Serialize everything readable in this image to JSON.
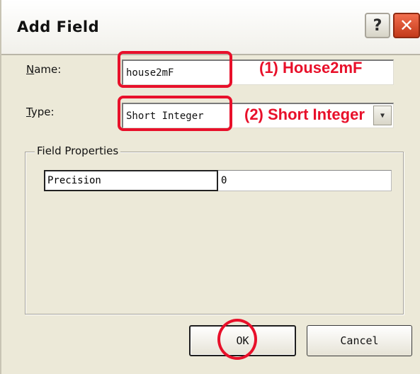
{
  "window": {
    "title": "Add Field",
    "help_glyph": "?",
    "close_glyph": "✕"
  },
  "form": {
    "name_label_prefix": "N",
    "name_label_rest": "ame:",
    "name_value": "house2mF",
    "type_label_prefix": "T",
    "type_label_rest": "ype:",
    "type_value": "Short Integer",
    "type_arrow": "▼"
  },
  "field_properties": {
    "legend": "Field Properties",
    "rows": [
      {
        "key": "Precision",
        "value": "0"
      }
    ]
  },
  "buttons": {
    "ok": "OK",
    "cancel": "Cancel"
  },
  "annotations": {
    "step1": "(1)  House2mF",
    "step2": "(2)  Short Integer",
    "color": "#e8102a"
  }
}
